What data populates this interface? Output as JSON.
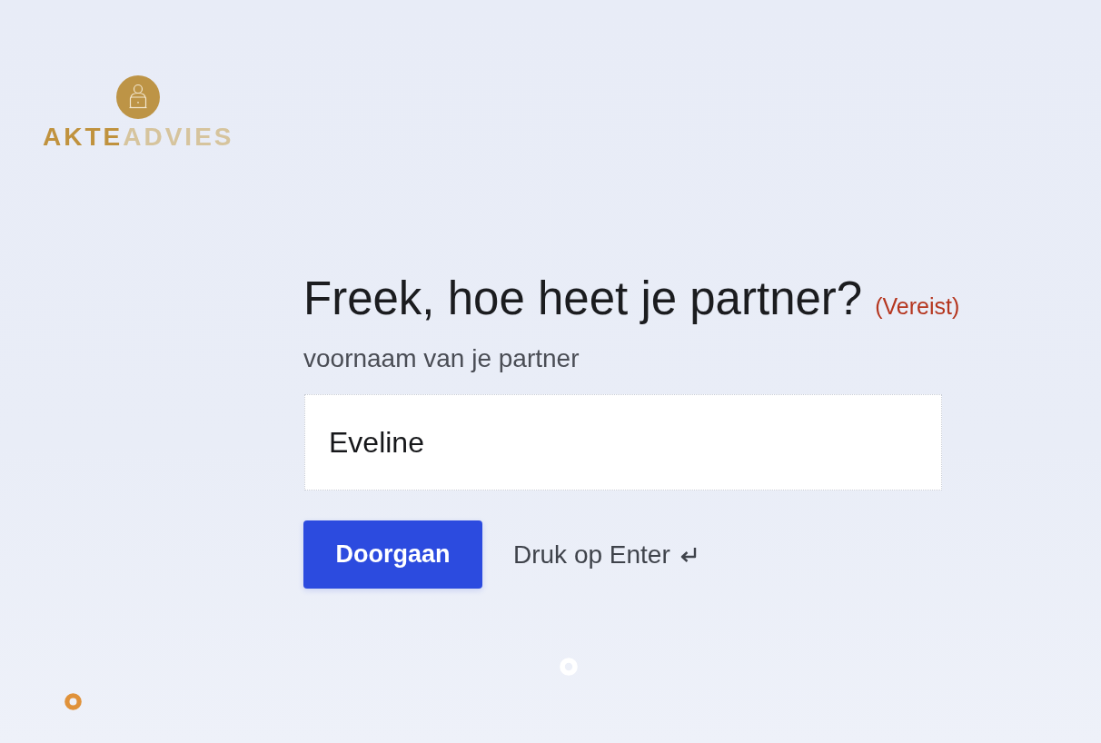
{
  "logo": {
    "text_primary": "AKTE",
    "text_secondary": "ADVIES"
  },
  "question": {
    "title": "Freek, hoe heet je partner?",
    "required_label": "(Vereist)",
    "description": "voornaam van je partner"
  },
  "answer": {
    "value": "Eveline"
  },
  "actions": {
    "continue_button": "Doorgaan",
    "hint": "Druk op Enter"
  }
}
